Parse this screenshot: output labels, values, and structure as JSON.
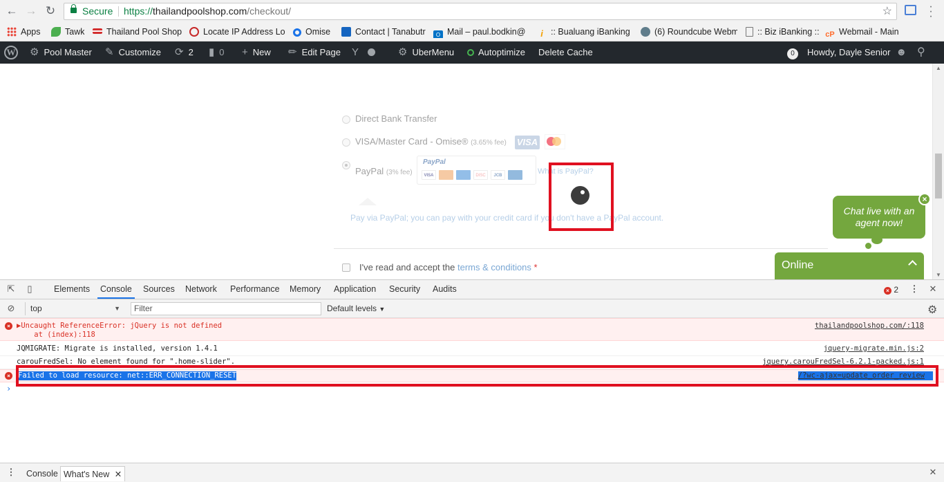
{
  "browser": {
    "secure_label": "Secure",
    "url_scheme": "https://",
    "url_domain": "thailandpoolshop.com",
    "url_path": "/checkout/",
    "bookmarks": [
      {
        "label": "Apps",
        "icon": "apps-grid-icon"
      },
      {
        "label": "Tawk",
        "icon": "tawk-icon",
        "color": "#4caf50"
      },
      {
        "label": "Thailand Pool Shop",
        "icon": "pool-shop-icon",
        "color": "#d32f2f"
      },
      {
        "label": "Locate IP Address Lo",
        "icon": "globe-icon",
        "color": "#c62828"
      },
      {
        "label": "Omise",
        "icon": "omise-icon",
        "color": "#1a73e8"
      },
      {
        "label": "Contact | Tanabutr",
        "icon": "contact-icon",
        "color": "#1565c0"
      },
      {
        "label": "Mail – paul.bodkin@",
        "icon": "outlook-icon",
        "color": "#0072c6"
      },
      {
        "label": ":: Bualuang iBanking :",
        "icon": "bualuang-icon",
        "color": "#f4a000"
      },
      {
        "label": "(6) Roundcube Webm",
        "icon": "roundcube-icon",
        "color": "#37474f"
      },
      {
        "label": ":: Biz iBanking ::",
        "icon": "page-icon",
        "color": "#888888"
      },
      {
        "label": "Webmail - Main",
        "icon": "cpanel-icon",
        "color": "#ff6c2c"
      }
    ]
  },
  "wp_admin": {
    "site_name": "Pool Master",
    "customize": "Customize",
    "updates_count": "2",
    "comments_count": "0",
    "new": "New",
    "edit_page": "Edit Page",
    "ubermenu": "UberMenu",
    "autoptimize": "Autoptimize",
    "delete_cache": "Delete Cache",
    "notif_count": "0",
    "howdy": "Howdy, Dayle Senior"
  },
  "checkout": {
    "bank_transfer": "Direct Bank Transfer",
    "card_label": "VISA/Master Card - Omise®",
    "card_fee": "(3.65% fee)",
    "visa_logo": "VISA",
    "paypal_label": "PayPal",
    "paypal_fee": "(3% fee)",
    "paypal_logo": "PayPal",
    "what_is_paypal": "What is PayPal?",
    "paypal_desc": "Pay via PayPal; you can pay with your credit card if you don't have a PayPal account.",
    "terms_prefix": "I've read and accept the",
    "terms_link": "terms & conditions",
    "terms_required": "*"
  },
  "chat": {
    "bubble": "Chat live with an agent now!",
    "status": "Online",
    "accent": "#74a73e"
  },
  "devtools": {
    "tabs": [
      "Elements",
      "Console",
      "Sources",
      "Network",
      "Performance",
      "Memory",
      "Application",
      "Security",
      "Audits"
    ],
    "active_tab": "Console",
    "error_count": "2",
    "context": "top",
    "filter_placeholder": "Filter",
    "levels": "Default levels",
    "messages": [
      {
        "type": "error",
        "text": "▶Uncaught ReferenceError: jQuery is not defined",
        "text2": "    at (index):118",
        "source": "thailandpoolshop.com/:118"
      },
      {
        "type": "log",
        "text": "JQMIGRATE: Migrate is installed, version 1.4.1",
        "source": "jquery-migrate.min.js:2"
      },
      {
        "type": "log",
        "text": "carouFredSel: No element found for \".home-slider\".",
        "source": "jquery.carouFredSel-6.2.1-packed.js:1"
      },
      {
        "type": "error",
        "text": "Failed to load resource: net::ERR_CONNECTION_RESET",
        "source": "/?wc-ajax=update_order_review"
      }
    ],
    "drawer_tabs": [
      "Console",
      "What's New"
    ]
  }
}
